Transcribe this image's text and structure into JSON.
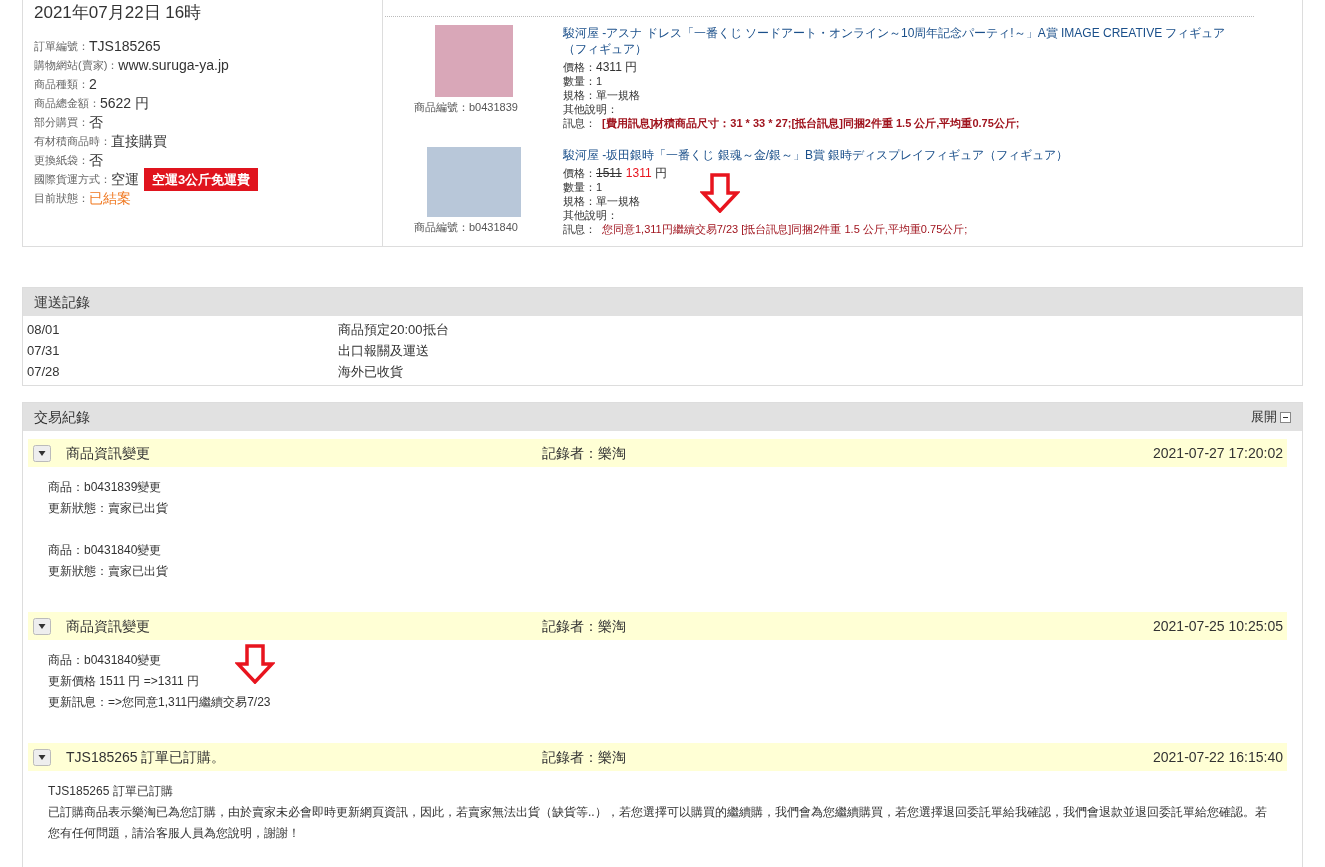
{
  "order": {
    "date": "2021年07月22日 16時",
    "fields": [
      {
        "kind": "plain",
        "label": "訂單編號：",
        "value": "TJS185265"
      },
      {
        "kind": "plain",
        "label": "購物網站(賣家)：",
        "value": "www.suruga-ya.jp"
      },
      {
        "kind": "plain",
        "label": "商品種類：",
        "value": "2"
      },
      {
        "kind": "plain",
        "label": "商品總金額：",
        "value": "5622 円"
      },
      {
        "kind": "plain",
        "label": "部分購買：",
        "value": "否"
      },
      {
        "kind": "plain",
        "label": "有材積商品時：",
        "value": "直接購買"
      },
      {
        "kind": "plain",
        "label": "更換紙袋：",
        "value": "否"
      },
      {
        "kind": "plain",
        "label": "國際貨運方式：",
        "value": "空運",
        "badge": "空運3公斤免運費"
      },
      {
        "kind": "status",
        "label": "目前狀態：",
        "value": "已結案"
      }
    ]
  },
  "products": [
    {
      "title": "駿河屋 -アスナ ドレス「一番くじ ソードアート・オンライン～10周年記念パーティ!～」A賞 IMAGE CREATIVE フィギュア（フィギュア）",
      "code_label": "商品編號：",
      "code": "b0431839",
      "price_label": "價格：",
      "price": "4311",
      "unit": "円",
      "qty_label": "數量：",
      "qty": "1",
      "spec_label": "規格：",
      "spec": "單一規格",
      "note_label": "其他說明：",
      "msg_label": "訊息：",
      "msg": "[費用訊息]材積商品尺寸：31 * 33 * 27;[抵台訊息]同捆2件重 1.5 公斤,平均重0.75公斤;",
      "msg_bold": true
    },
    {
      "title": "駿河屋 -坂田銀時「一番くじ 銀魂～金/銀～」B賞 銀時ディスプレイフィギュア（フィギュア）",
      "code_label": "商品編號：",
      "code": "b0431840",
      "price_label": "價格：",
      "old_price": "1511",
      "price": "1311",
      "unit": "円",
      "qty_label": "數量：",
      "qty": "1",
      "spec_label": "規格：",
      "spec": "單一規格",
      "note_label": "其他說明：",
      "msg_label": "訊息：",
      "msg": "您同意1,311円繼續交易7/23  [抵台訊息]同捆2件重 1.5 公斤,平均重0.75公斤;",
      "msg_bold": false,
      "arrow": true
    }
  ],
  "shipping": {
    "title": "運送記錄",
    "rows": [
      {
        "date": "08/01",
        "event": "商品預定20:00抵台"
      },
      {
        "date": "07/31",
        "event": "出口報關及運送"
      },
      {
        "date": "07/28",
        "event": "海外已收貨"
      }
    ]
  },
  "transactions": {
    "title": "交易紀錄",
    "toggle_label": "展開",
    "expanded": true,
    "entries": [
      {
        "title": "商品資訊變更",
        "recorder": "記錄者：樂淘",
        "time": "2021-07-27 17:20:02",
        "groups": [
          [
            "商品：b0431839變更",
            "更新狀態：賣家已出貨"
          ],
          [
            "商品：b0431840變更",
            "更新狀態：賣家已出貨"
          ]
        ]
      },
      {
        "title": "商品資訊變更",
        "recorder": "記錄者：樂淘",
        "time": "2021-07-25 10:25:05",
        "groups": [
          [
            "商品：b0431840變更",
            "更新價格 1511 円 =>1311 円",
            "更新訊息：=>您同意1,311円繼續交易7/23"
          ]
        ],
        "arrow": true
      },
      {
        "title": "TJS185265 訂單已訂購。",
        "recorder": "記錄者：樂淘",
        "time": "2021-07-22 16:15:40",
        "groups": [
          [
            "TJS185265 訂單已訂購",
            "已訂購商品表示樂淘已為您訂購，由於賣家未必會即時更新網頁資訊，因此，若賣家無法出貨（缺貨等..），若您選擇可以購買的繼續購，我們會為您繼續購買，若您選擇退回委託單給我確認，我們會退款並退回委託單給您確認。若您有任何問題，請洽客服人員為您說明，謝謝！"
          ]
        ]
      }
    ]
  }
}
